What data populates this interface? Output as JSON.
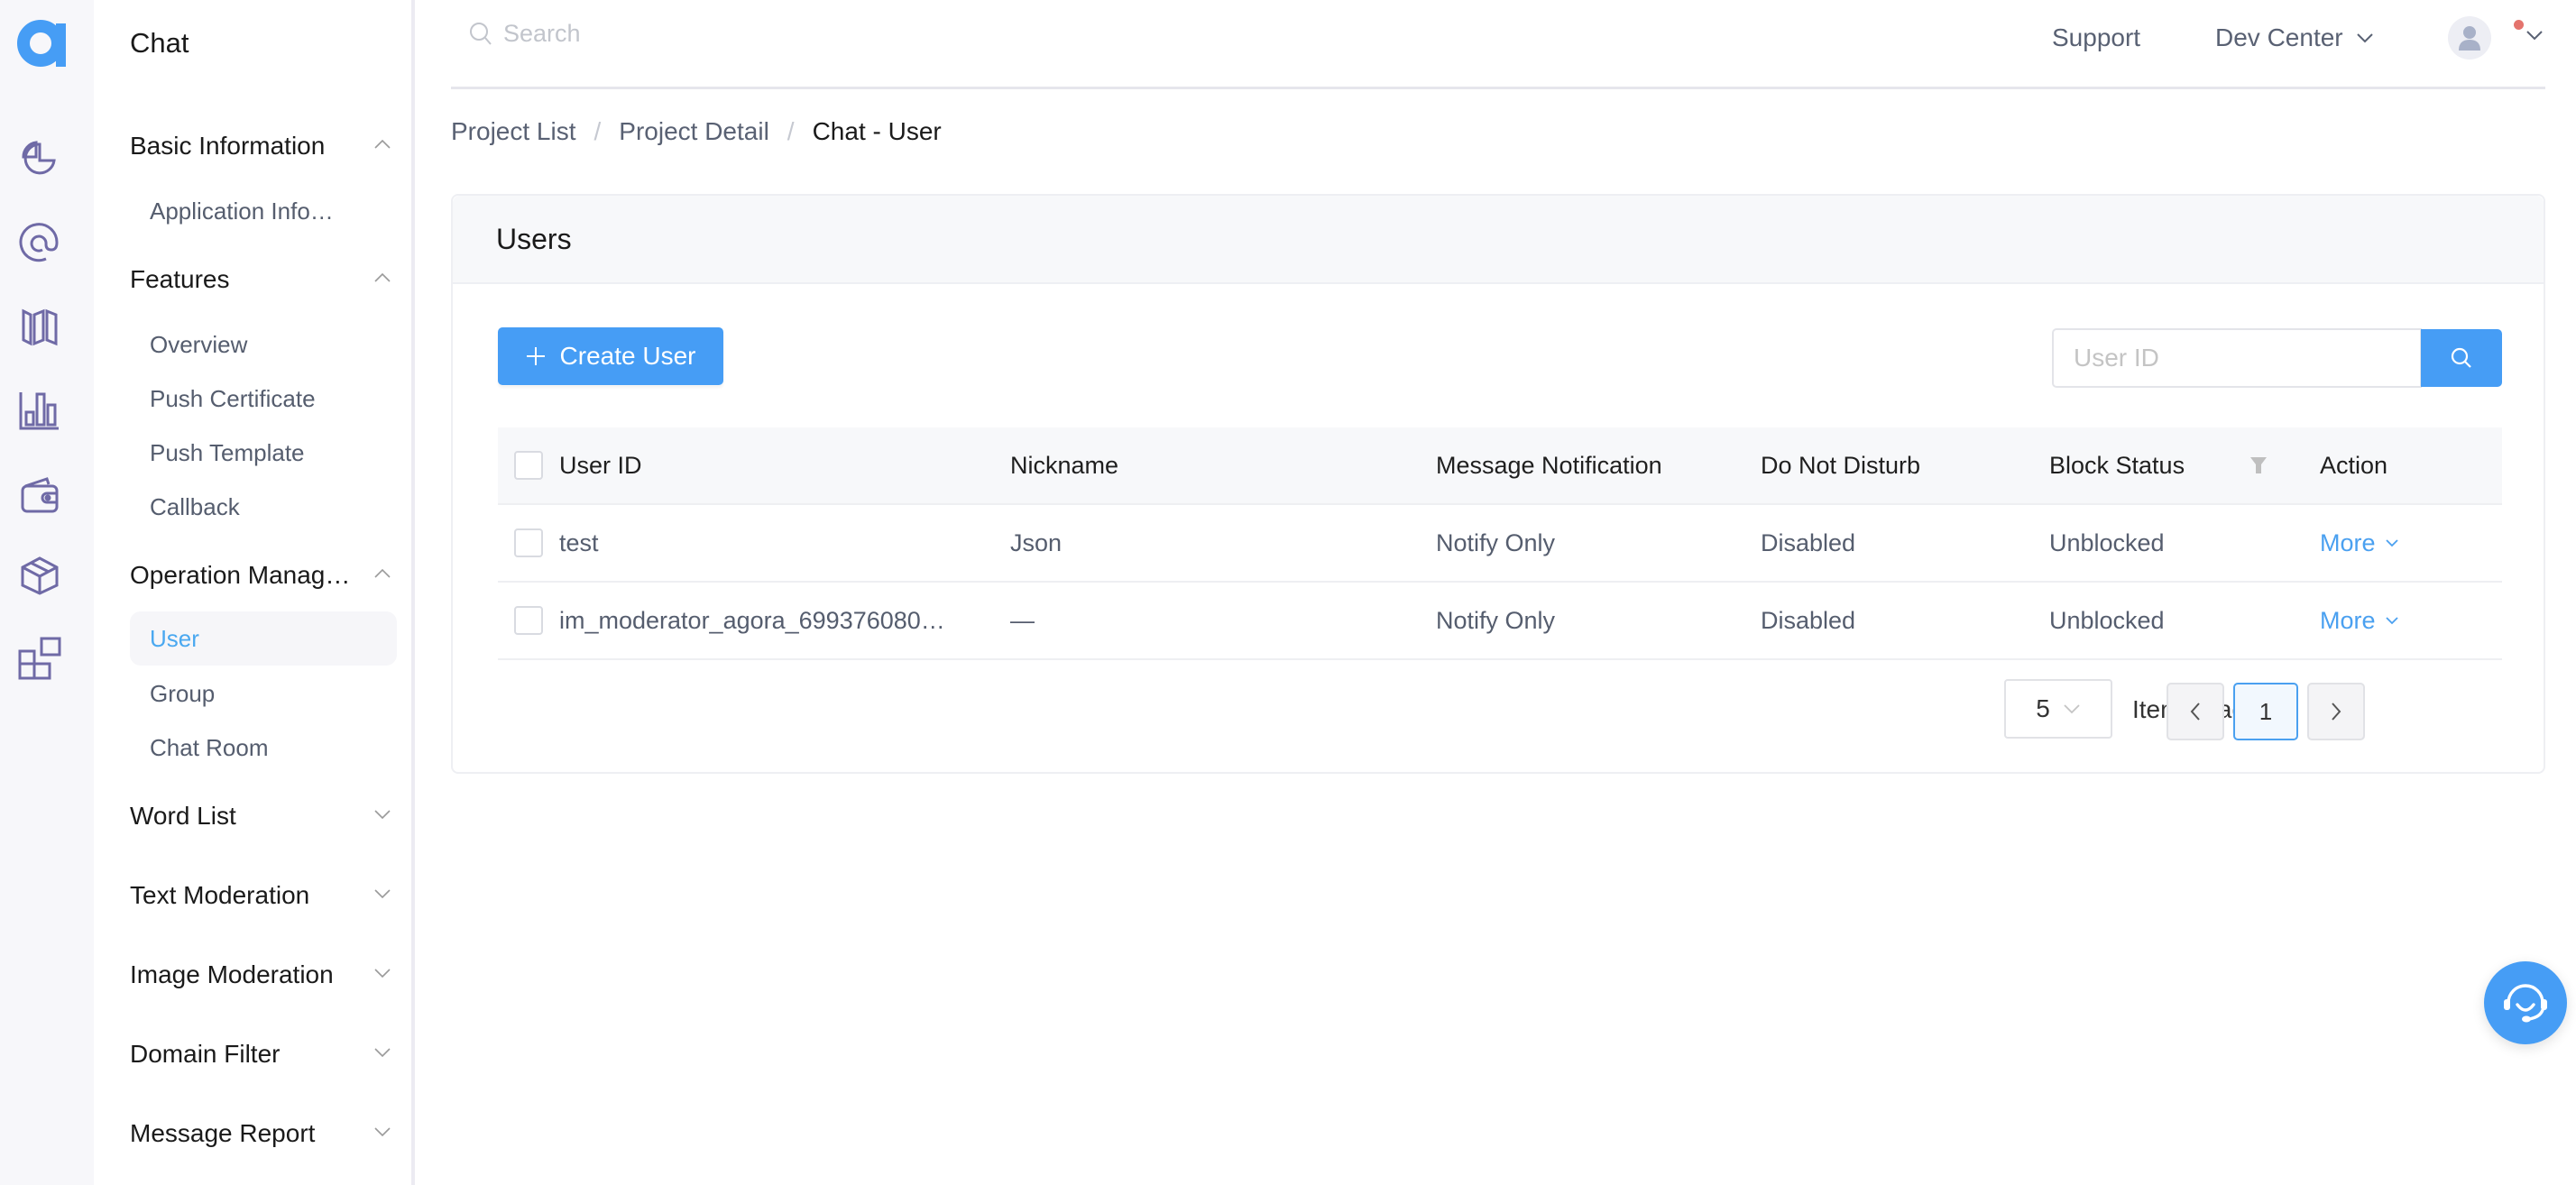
{
  "app": {
    "title": "Chat",
    "brand_color": "#469df5"
  },
  "rail": {
    "icons": [
      "logo-icon",
      "pie-chart-icon",
      "at-sign-icon",
      "map-icon",
      "bar-chart-icon",
      "wallet-icon",
      "box-icon",
      "apps-icon"
    ]
  },
  "menu": {
    "groups": [
      {
        "label": "Basic Information",
        "expanded": true,
        "items": [
          "Application Info…"
        ]
      },
      {
        "label": "Features",
        "expanded": true,
        "items": [
          "Overview",
          "Push Certificate",
          "Push Template",
          "Callback"
        ]
      },
      {
        "label": "Operation Manag…",
        "expanded": true,
        "items": [
          "User",
          "Group",
          "Chat Room"
        ],
        "active": "User"
      },
      {
        "label": "Word List",
        "expanded": false
      },
      {
        "label": "Text Moderation",
        "expanded": false
      },
      {
        "label": "Image Moderation",
        "expanded": false
      },
      {
        "label": "Domain Filter",
        "expanded": false
      },
      {
        "label": "Message Report",
        "expanded": false
      }
    ]
  },
  "header": {
    "search_placeholder": "Search",
    "support": "Support",
    "dev_center": "Dev Center",
    "has_notification": true
  },
  "breadcrumb": [
    "Project List",
    "Project Detail",
    "Chat - User"
  ],
  "card": {
    "title": "Users",
    "create_button": "Create User",
    "user_id_placeholder": "User ID"
  },
  "table": {
    "columns": [
      "User ID",
      "Nickname",
      "Message Notification",
      "Do Not Disturb",
      "Block Status",
      "Action"
    ],
    "rows": [
      {
        "user_id": "test",
        "nickname": "Json",
        "notification": "Notify Only",
        "dnd": "Disabled",
        "block": "Unblocked",
        "action": "More"
      },
      {
        "user_id": "im_moderator_agora_699376080…",
        "nickname": "—",
        "notification": "Notify Only",
        "dnd": "Disabled",
        "block": "Unblocked",
        "action": "More"
      }
    ]
  },
  "pagination": {
    "page_size": "5",
    "label": "Items/Page",
    "current_page": "1"
  }
}
